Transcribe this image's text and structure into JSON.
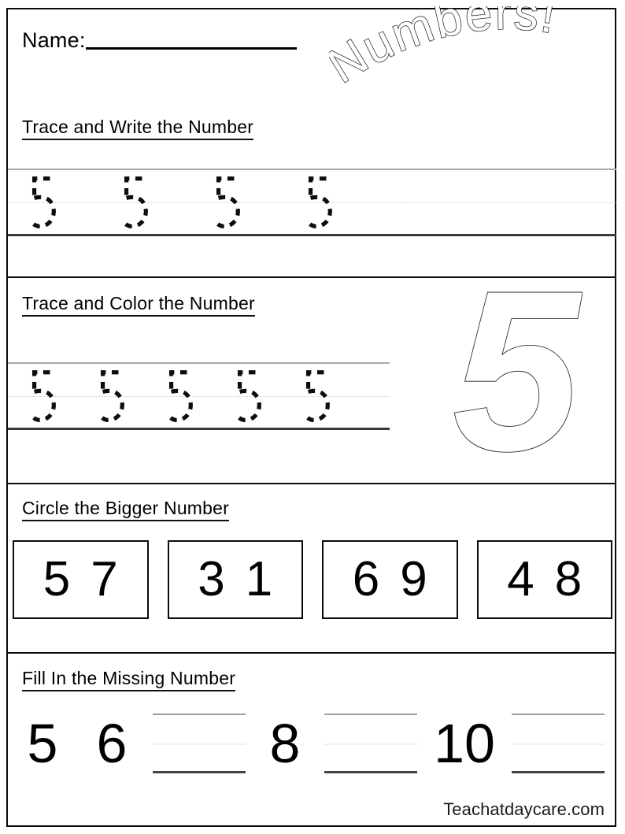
{
  "page": {
    "title": "Numbers!",
    "footer": "Teachatdaycare.com",
    "target_number": "5"
  },
  "header": {
    "name_label": "Name:"
  },
  "sections": [
    {
      "heading": "Trace and  Write the Number",
      "trace_glyph": "5",
      "trace_count": 4
    },
    {
      "heading": "Trace and  Color the Number",
      "trace_glyph": "5",
      "trace_count": 5,
      "color_numeral": "5"
    },
    {
      "heading": "Circle the Bigger Number",
      "pairs": [
        {
          "left": "5",
          "right": "7"
        },
        {
          "left": "3",
          "right": "1"
        },
        {
          "left": "6",
          "right": "9"
        },
        {
          "left": "4",
          "right": "8"
        }
      ]
    },
    {
      "heading": "Fill In the Missing Number",
      "sequence": [
        {
          "type": "number",
          "value": "5"
        },
        {
          "type": "number",
          "value": "6"
        },
        {
          "type": "blank",
          "value": ""
        },
        {
          "type": "number",
          "value": "8"
        },
        {
          "type": "blank",
          "value": ""
        },
        {
          "type": "number",
          "value": "10"
        },
        {
          "type": "blank",
          "value": ""
        }
      ]
    }
  ],
  "colors": {
    "ink": "#000000",
    "guide_top": "#a8a8a8",
    "guide_mid": "#cfcfcf",
    "guide_base": "#3a3a3a",
    "paper": "#ffffff"
  }
}
